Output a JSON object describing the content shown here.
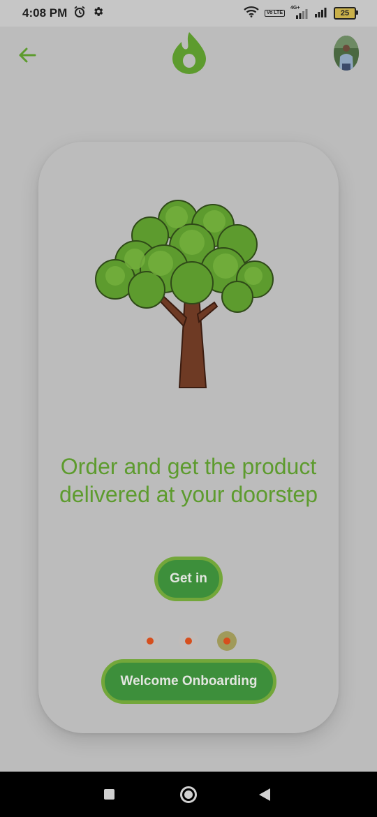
{
  "status_bar": {
    "time": "4:08 PM",
    "icons": [
      "alarm-icon",
      "settings-gear-icon",
      "wifi-icon",
      "volte-icon",
      "signal-4g-icon",
      "signal-icon",
      "battery-icon"
    ],
    "volte_label": "Vo LTE",
    "network_label": "4G+",
    "battery_level": "25"
  },
  "header": {
    "back_icon": "arrow-left-icon",
    "logo_icon": "flame-logo-icon",
    "avatar_icon": "user-avatar"
  },
  "onboarding": {
    "illustration": "tree-illustration",
    "headline_line1": "Order and get the product",
    "headline_line2": "delivered at your doorstep",
    "get_in_label": "Get in",
    "page_count": 3,
    "active_page": 3,
    "welcome_label": "Welcome Onboarding"
  },
  "colors": {
    "accent_green": "#5d9b2e",
    "button_green": "#3d8f3b",
    "button_border": "#73a73a",
    "dot_orange": "#d64e1c",
    "overlay_gray": "#bcbcbc"
  },
  "nav_bar": {
    "icons": [
      "recents-square-icon",
      "home-circle-icon",
      "back-triangle-icon"
    ]
  }
}
